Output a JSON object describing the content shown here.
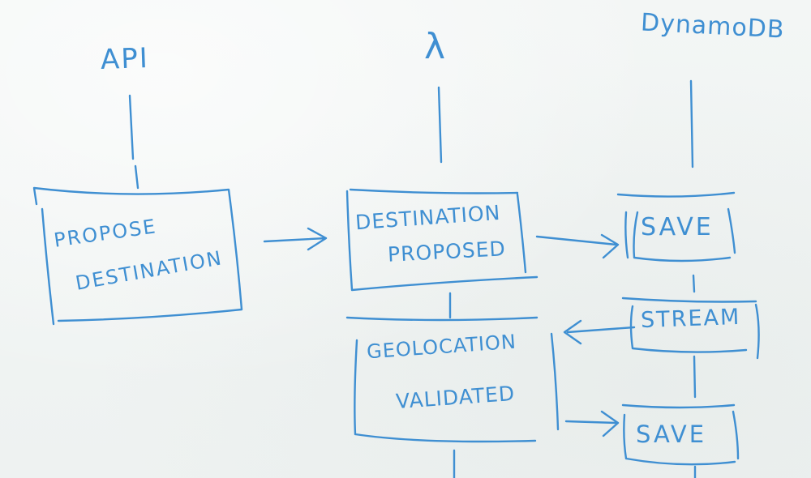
{
  "colors": {
    "ink": "#3f8fd2",
    "board": "#f3f6f5"
  },
  "columns": {
    "api": "API",
    "lambda": "λ",
    "dynamodb": "DynamoDB"
  },
  "boxes": {
    "propose": {
      "line1": "PROPOSE",
      "line2": "DESTINATION"
    },
    "destination_proposed": {
      "line1": "DESTINATION",
      "line2": "PROPOSED"
    },
    "save_top": {
      "label": "SAVE"
    },
    "stream": {
      "label": "STREAM"
    },
    "geolocation_validated": {
      "line1": "GEOLOCATION",
      "line2": "VALIDATED"
    },
    "save_bottom": {
      "label": "SAVE"
    }
  }
}
